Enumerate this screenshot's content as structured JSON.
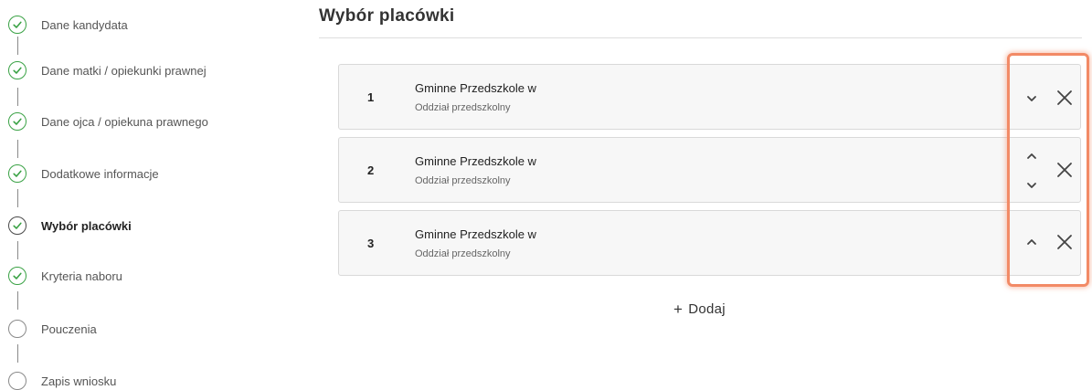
{
  "sidebar": {
    "steps": [
      {
        "label": "Dane kandydata",
        "state": "done"
      },
      {
        "label": "Dane matki / opiekunki prawnej",
        "state": "done"
      },
      {
        "label": "Dane ojca / opiekuna prawnego",
        "state": "done"
      },
      {
        "label": "Dodatkowe informacje",
        "state": "done"
      },
      {
        "label": "Wybór placówki",
        "state": "current"
      },
      {
        "label": "Kryteria naboru",
        "state": "done"
      },
      {
        "label": "Pouczenia",
        "state": "pending"
      },
      {
        "label": "Zapis wniosku",
        "state": "pending"
      }
    ]
  },
  "main": {
    "title": "Wybór placówki",
    "choices": [
      {
        "number": "1",
        "name": "Gminne Przedszkole w",
        "type": "Oddział przedszkolny",
        "controls": [
          "chevron-down-icon",
          "close-icon"
        ]
      },
      {
        "number": "2",
        "name": "Gminne Przedszkole w",
        "type": "Oddział przedszkolny",
        "controls": [
          "chevron-up-icon",
          "chevron-down-icon",
          "close-icon"
        ]
      },
      {
        "number": "3",
        "name": "Gminne Przedszkole w",
        "type": "Oddział przedszkolny",
        "controls": [
          "chevron-up-icon",
          "close-icon"
        ]
      }
    ],
    "add_label": "Dodaj",
    "add_icon": "plus-icon"
  },
  "colors": {
    "done": "#3aa245",
    "highlight": "#f28a66",
    "card_bg": "#f7f7f7",
    "card_border": "#d9d9d9"
  }
}
